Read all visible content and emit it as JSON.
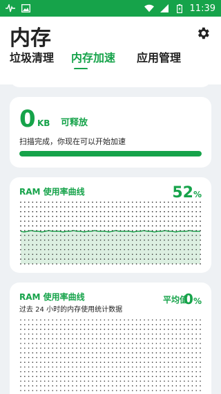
{
  "status_bar": {
    "time": "11:39",
    "left_icons": [
      "pulse-icon",
      "image-icon"
    ],
    "right_icons": [
      "wifi-icon",
      "signal-icon",
      "battery-icon"
    ]
  },
  "header": {
    "title": "内存",
    "settings_icon": "gear-icon"
  },
  "tabs": [
    {
      "label": "垃圾清理",
      "active": false
    },
    {
      "label": "内存加速",
      "active": true
    },
    {
      "label": "应用管理",
      "active": false
    }
  ],
  "free_card": {
    "value": "0",
    "unit": "KB",
    "label": "可释放",
    "status": "扫描完成，你现在可以开始加速",
    "progress": 1.0
  },
  "ram_card": {
    "title": "RAM 使用率曲线",
    "percent": "52",
    "percent_symbol": "%"
  },
  "ram_history_card": {
    "title": "RAM 使用率曲线",
    "subtitle": "过去 24 小时的内存使用统计数据",
    "avg_label": "平均值",
    "avg_value": "0",
    "avg_symbol": "%"
  },
  "colors": {
    "accent": "#16a34a",
    "fill": "#d6ecdc",
    "dot": "#333333"
  },
  "chart_data": [
    {
      "type": "area",
      "title": "RAM 使用率曲线",
      "y_unit": "%",
      "series": [
        {
          "values": [
            52,
            51,
            52,
            53,
            52,
            52,
            51,
            52,
            53,
            52,
            52,
            52,
            51,
            52,
            52,
            53,
            52,
            52,
            51,
            52,
            52,
            53,
            52,
            52,
            52,
            51,
            52,
            53,
            52,
            52,
            52,
            52,
            51,
            52,
            52,
            53,
            52,
            52,
            51,
            52,
            52,
            53,
            52,
            52,
            51,
            52,
            52,
            52,
            53,
            52,
            52,
            52
          ]
        }
      ],
      "ylim": [
        0,
        100
      ],
      "grid": true
    },
    {
      "type": "line",
      "title": "RAM 使用率曲线",
      "series": [
        {
          "values": []
        }
      ],
      "ylim": [
        0,
        100
      ],
      "grid": true
    }
  ]
}
